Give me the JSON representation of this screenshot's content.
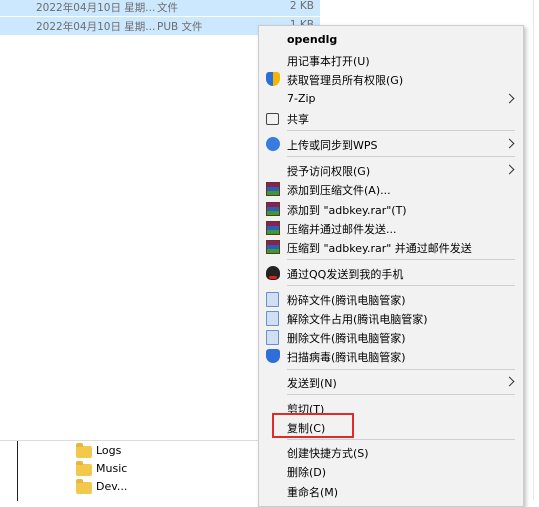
{
  "file_rows": [
    {
      "date": "2022年04月10日 星期...",
      "type": "文件",
      "size": "2 KB"
    },
    {
      "date": "2022年04月10日 星期...",
      "type": "PUB 文件",
      "size": "1 KB"
    }
  ],
  "folders": [
    "Logs",
    "Music",
    "Dev..."
  ],
  "menu": {
    "title": "opendlg",
    "items": [
      {
        "label": "用记事本打开(U)"
      },
      {
        "label": "获取管理员所有权限(G)",
        "icon": "shield-icon"
      },
      {
        "label": "7-Zip"
      },
      {
        "label": "共享",
        "icon": "share-icon"
      },
      {
        "label": "上传或同步到WPS",
        "icon": "cloud-upload-icon"
      },
      {
        "label": "授予访问权限(G)"
      },
      {
        "label": "添加到压缩文件(A)...",
        "icon": "winrar-icon"
      },
      {
        "label": "添加到 \"adbkey.rar\"(T)",
        "icon": "winrar-icon"
      },
      {
        "label": "压缩并通过邮件发送...",
        "icon": "winrar-icon"
      },
      {
        "label": "压缩到 \"adbkey.rar\" 并通过邮件发送",
        "icon": "winrar-icon"
      },
      {
        "label": "通过QQ发送到我的手机",
        "icon": "qq-icon"
      },
      {
        "label": "粉碎文件(腾讯电脑管家)",
        "icon": "shred-icon"
      },
      {
        "label": "解除文件占用(腾讯电脑管家)",
        "icon": "unlock-file-icon"
      },
      {
        "label": "删除文件(腾讯电脑管家)",
        "icon": "delete-file-icon"
      },
      {
        "label": "扫描病毒(腾讯电脑管家)",
        "icon": "virus-scan-icon"
      },
      {
        "label": "发送到(N)"
      },
      {
        "label": "剪切(T)"
      },
      {
        "label": "复制(C)"
      },
      {
        "label": "创建快捷方式(S)"
      },
      {
        "label": "删除(D)"
      },
      {
        "label": "重命名(M)"
      }
    ]
  },
  "colors": {
    "selection_bg": "#cce8ff",
    "menu_bg": "#f2f2f2",
    "highlight_border": "#e12b2b"
  }
}
